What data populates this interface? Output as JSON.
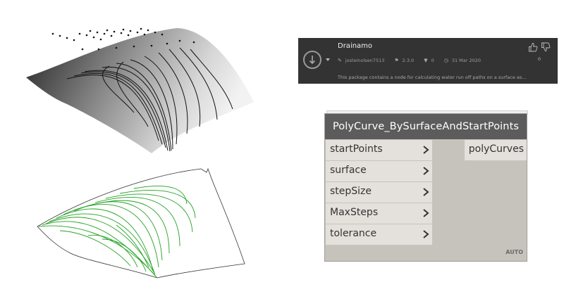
{
  "package": {
    "name": "Drainamo",
    "author": "josteinolsen7513",
    "version": "2.3.0",
    "downloads": "0",
    "date": "31 Mar 2020",
    "votes": "0",
    "description": "This package contains a node for calculating water run off paths on a surface as..."
  },
  "node": {
    "title": "PolyCurve_BySurfaceAndStartPoints",
    "inputs": [
      {
        "label": "startPoints"
      },
      {
        "label": "surface"
      },
      {
        "label": "stepSize"
      },
      {
        "label": "MaxSteps"
      },
      {
        "label": "tolerance"
      }
    ],
    "outputs": [
      {
        "label": "polyCurves"
      }
    ],
    "lacing": "AUTO"
  },
  "colors": {
    "card_bg": "#333333",
    "node_header": "#5c5c5c",
    "node_body": "#c6c3bd",
    "port_bg": "#e4e1dc",
    "path_green": "#22a122"
  },
  "icons": [
    "download-icon",
    "pencil-icon",
    "flag-icon",
    "downloads-icon",
    "clock-icon",
    "thumbs-up-icon",
    "thumbs-down-icon",
    "chevron-right-icon"
  ]
}
